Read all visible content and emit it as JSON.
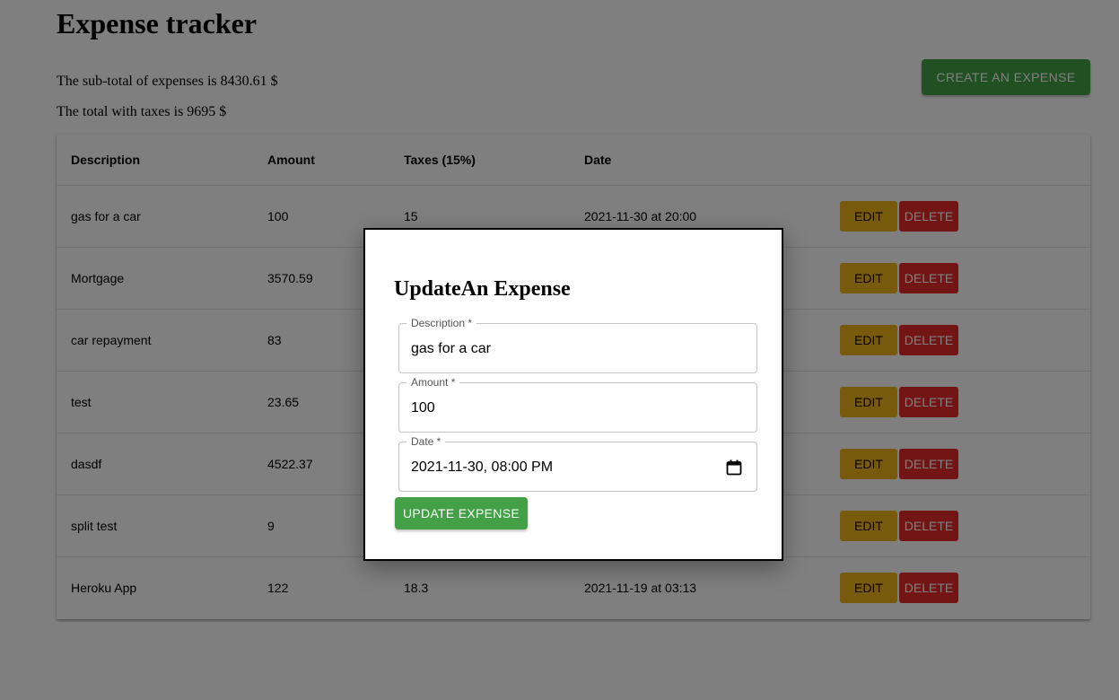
{
  "app": {
    "title": "Expense tracker",
    "subtotal_text": "The sub-total of expenses is 8430.61 $",
    "total_text": "The total with taxes is 9695 $",
    "create_label": "CREATE AN EXPENSE"
  },
  "table": {
    "headers": [
      "Description",
      "Amount",
      "Taxes (15%)",
      "Date"
    ],
    "rows": [
      {
        "description": "gas for a car",
        "amount": "100",
        "taxes": "15",
        "date": "2021-11-30 at 20:00",
        "edit_label": "EDIT",
        "delete_label": "DELETE"
      },
      {
        "description": "Mortgage",
        "amount": "3570.59",
        "taxes": "",
        "date": "",
        "edit_label": "EDIT",
        "delete_label": "DELETE"
      },
      {
        "description": "car repayment",
        "amount": "83",
        "taxes": "",
        "date": "",
        "edit_label": "EDIT",
        "delete_label": "DELETE"
      },
      {
        "description": "test",
        "amount": "23.65",
        "taxes": "",
        "date": "",
        "edit_label": "EDIT",
        "delete_label": "DELETE"
      },
      {
        "description": "dasdf",
        "amount": "4522.37",
        "taxes": "",
        "date": "",
        "edit_label": "EDIT",
        "delete_label": "DELETE"
      },
      {
        "description": "split test",
        "amount": "9",
        "taxes": "",
        "date": "",
        "edit_label": "EDIT",
        "delete_label": "DELETE"
      },
      {
        "description": "Heroku App",
        "amount": "122",
        "taxes": "18.3",
        "date": "2021-11-19 at 03:13",
        "edit_label": "EDIT",
        "delete_label": "DELETE"
      }
    ]
  },
  "modal": {
    "title": "UpdateAn Expense",
    "fields": {
      "description": {
        "label": "Description *",
        "value": "gas for a car"
      },
      "amount": {
        "label": "Amount *",
        "value": "100"
      },
      "date": {
        "label": "Date *",
        "value": "2021-11-30, 08:00 PM"
      }
    },
    "submit_label": "UPDATE EXPENSE"
  },
  "colors": {
    "primary_green": "#43a047",
    "edit_yellow": "#f1b51b",
    "delete_red": "#e62b2b",
    "overlay": "rgba(0,0,0,0.5)"
  },
  "icons": {
    "date_picker": "calendar-icon"
  }
}
